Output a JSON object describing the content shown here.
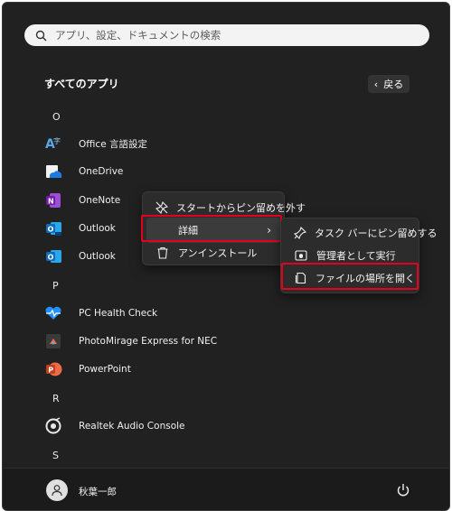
{
  "search": {
    "placeholder": "アプリ、設定、ドキュメントの検索"
  },
  "header": {
    "title": "すべてのアプリ",
    "back_label": "戻る"
  },
  "groups": {
    "o": "O",
    "p": "P",
    "r": "R",
    "s": "S"
  },
  "apps": [
    {
      "label": "Office 言語設定",
      "icon": "office-language-icon"
    },
    {
      "label": "OneDrive",
      "icon": "onedrive-icon"
    },
    {
      "label": "OneNote",
      "icon": "onenote-icon"
    },
    {
      "label": "Outlook",
      "icon": "outlook-new-icon"
    },
    {
      "label": "Outlook",
      "icon": "outlook-icon"
    },
    {
      "label": "PC Health Check",
      "icon": "pc-health-check-icon"
    },
    {
      "label": "PhotoMirage Express for NEC",
      "icon": "photomirage-icon"
    },
    {
      "label": "PowerPoint",
      "icon": "powerpoint-icon"
    },
    {
      "label": "Realtek Audio Console",
      "icon": "realtek-audio-icon"
    }
  ],
  "context_menu": {
    "items": [
      {
        "label": "スタートからピン留めを外す",
        "icon": "unpin-icon"
      },
      {
        "label": "詳細",
        "icon": ""
      },
      {
        "label": "アンインストール",
        "icon": "trash-icon"
      }
    ]
  },
  "submenu": {
    "items": [
      {
        "label": "タスク バーにピン留めする",
        "icon": "pin-icon"
      },
      {
        "label": "管理者として実行",
        "icon": "admin-shield-icon"
      },
      {
        "label": "ファイルの場所を開く",
        "icon": "open-folder-icon"
      }
    ]
  },
  "user": {
    "name": "秋葉一郎"
  },
  "colors": {
    "highlight_border": "#e6001f",
    "background": "#212121"
  }
}
